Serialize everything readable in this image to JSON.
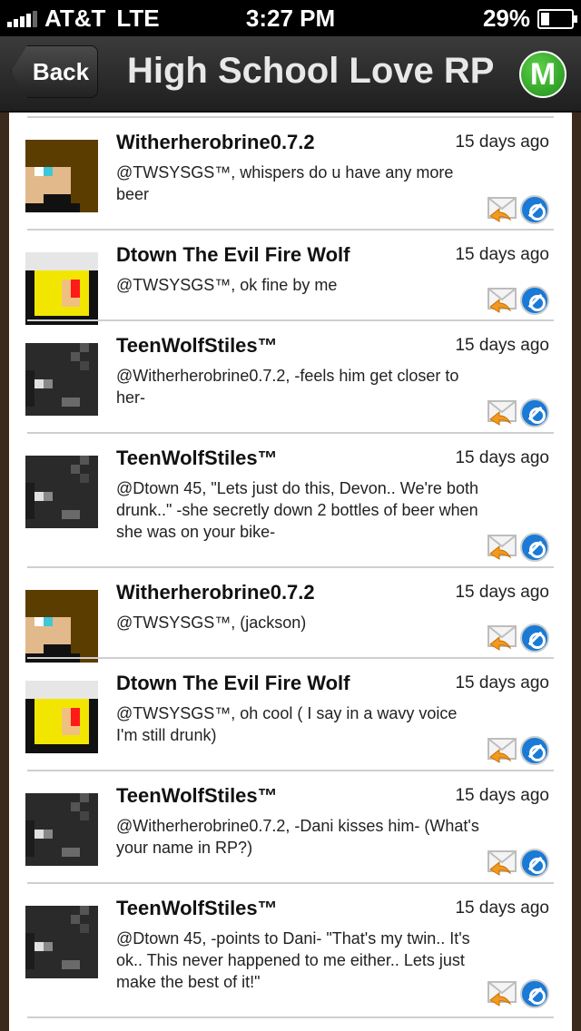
{
  "status_bar": {
    "carrier": "AT&T",
    "network": "LTE",
    "time": "3:27 PM",
    "battery": "29%",
    "battery_level": 0.29
  },
  "nav": {
    "back_label": "Back",
    "title": "High School Love RP",
    "logo_letter": "M"
  },
  "posts": [
    {
      "author": "Witherherobrine0.7.2",
      "time": "15 days ago",
      "message": "@TWSYSGS™, whispers do u have any more beer",
      "avatar": "brown-hair-skin"
    },
    {
      "author": "Dtown The Evil Fire Wolf",
      "time": "15 days ago",
      "message": "@TWSYSGS™, ok fine by me",
      "avatar": "yellow-red-skin"
    },
    {
      "author": "TeenWolfStiles™",
      "time": "15 days ago",
      "message": "@Witherherobrine0.7.2, -feels him get closer to her-",
      "avatar": "dark-gray-skin"
    },
    {
      "author": "TeenWolfStiles™",
      "time": "15 days ago",
      "message": "@Dtown 45, \"Lets just do this, Devon.. We're both drunk..\" -she secretly down 2 bottles of beer when she was on your bike-",
      "avatar": "dark-gray-skin"
    },
    {
      "author": "Witherherobrine0.7.2",
      "time": "15 days ago",
      "message": "@TWSYSGS™, (jackson)",
      "avatar": "brown-hair-skin"
    },
    {
      "author": "Dtown The Evil Fire Wolf",
      "time": "15 days ago",
      "message": "@TWSYSGS™, oh cool ( I say in a wavy voice I'm still drunk)",
      "avatar": "yellow-red-skin"
    },
    {
      "author": "TeenWolfStiles™",
      "time": "15 days ago",
      "message": "@Witherherobrine0.7.2, -Dani kisses him- (What's your name in RP?)",
      "avatar": "dark-gray-skin"
    },
    {
      "author": "TeenWolfStiles™",
      "time": "15 days ago",
      "message": "@Dtown 45, -points to Dani- \"That's my twin.. It's ok.. This never happened to me either.. Lets just make the best of it!\"",
      "avatar": "dark-gray-skin"
    }
  ]
}
